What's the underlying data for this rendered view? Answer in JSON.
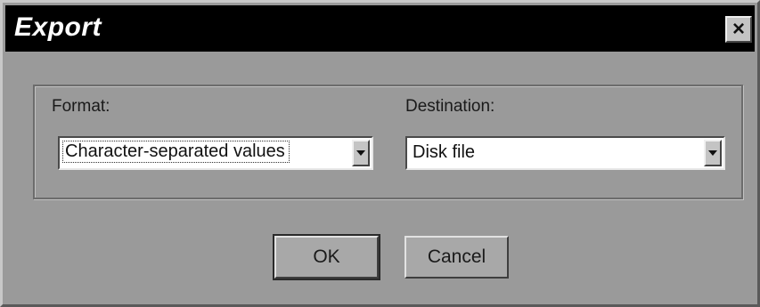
{
  "window": {
    "title": "Export",
    "close_glyph": "×",
    "close_icon": "close-icon"
  },
  "format": {
    "label": "Format:",
    "selected_value": "Character-separated values"
  },
  "destination": {
    "label": "Destination:",
    "selected_value": "Disk file"
  },
  "buttons": {
    "ok_label": "OK",
    "cancel_label": "Cancel"
  },
  "colors": {
    "titlebar": "#000000",
    "dialog_face": "#9a9a9a"
  }
}
